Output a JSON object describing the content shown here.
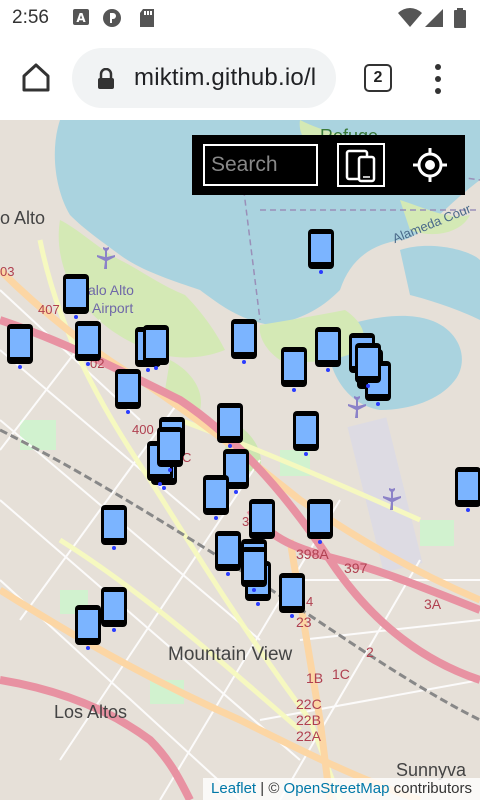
{
  "status_bar": {
    "time": "2:56",
    "icons": [
      "a-icon",
      "p-icon",
      "sd-card-icon",
      "wifi-icon",
      "signal-icon",
      "battery-icon"
    ]
  },
  "browser": {
    "url": "miktim.github.io/l",
    "tab_count": "2",
    "icons": [
      "home-icon",
      "lock-icon",
      "tabs-icon",
      "more-vert-icon"
    ]
  },
  "map_controls": {
    "search_placeholder": "Search",
    "icons": [
      "devices-icon",
      "locate-icon"
    ]
  },
  "map": {
    "places": {
      "mountain_view": "Mountain View",
      "los_altos": "Los Altos",
      "sunnyvale": "Sunnyva",
      "alto": "o Alto",
      "palo_alto_airport_1": "alo Alto",
      "palo_alto_airport_2": "Airport",
      "refuge": "Refuge",
      "alameda": "Alameda Cour"
    },
    "route_labels": [
      "03",
      "407",
      "02",
      "400",
      "398A",
      "397",
      "3A",
      "23",
      "2",
      "1C",
      "1B",
      "22C",
      "22B",
      "22A",
      "3",
      "4",
      "C"
    ],
    "marker_count": 33
  },
  "attribution": {
    "leaflet": "Leaflet",
    "sep": " | © ",
    "osm": "OpenStreetMap",
    "contributors": " contributors"
  },
  "colors": {
    "bay_water": "#aad3df",
    "marsh": "#d4e9b5",
    "land": "#e6e0d8",
    "marker_screen": "#7bb4ff",
    "control_bg": "#000000"
  }
}
